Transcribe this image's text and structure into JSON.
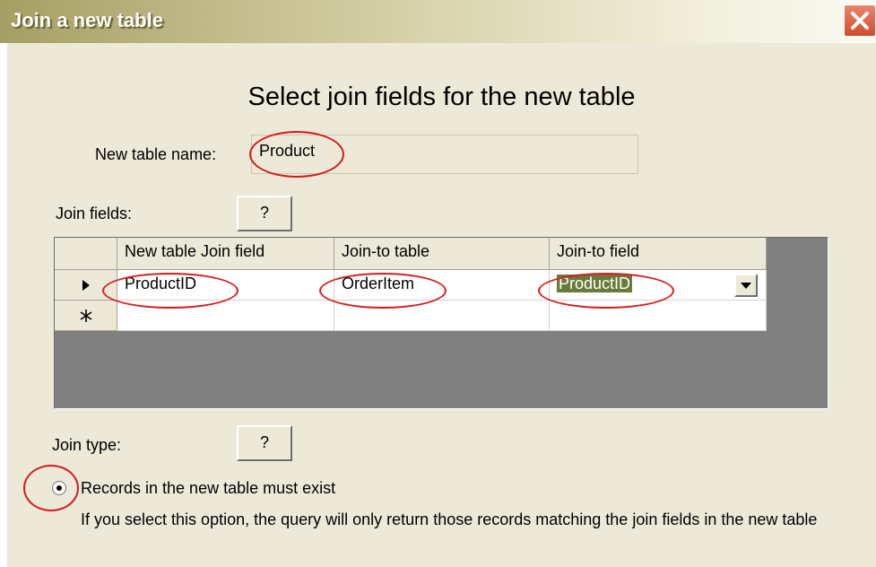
{
  "window": {
    "title": "Join a new table",
    "close_icon": "close-icon"
  },
  "heading": "Select join fields for the new table",
  "new_table": {
    "label": "New table name:",
    "value": "Product"
  },
  "join_fields": {
    "label": "Join fields:",
    "help_label": "?"
  },
  "grid": {
    "columns": [
      "New table Join field",
      "Join-to table",
      "Join-to field"
    ],
    "rows": [
      {
        "selector_icon": "current-row-arrow-icon",
        "new_table_field": "ProductID",
        "join_to_table": "OrderItem",
        "join_to_field": "ProductID"
      }
    ],
    "new_row_marker_icon": "new-record-asterisk-icon"
  },
  "join_type": {
    "label": "Join type:",
    "help_label": "?",
    "option_label": "Records in the new table must exist",
    "option_selected": true,
    "description": "If you select this option, the query will only return those records matching the join fields in the new table"
  },
  "colors": {
    "title_gradient_start": "#a59f63",
    "annotation_red": "#d61c1c",
    "dialog_face": "#ece9d8",
    "grid_background": "#808080",
    "selection": "#6a7a3a"
  }
}
